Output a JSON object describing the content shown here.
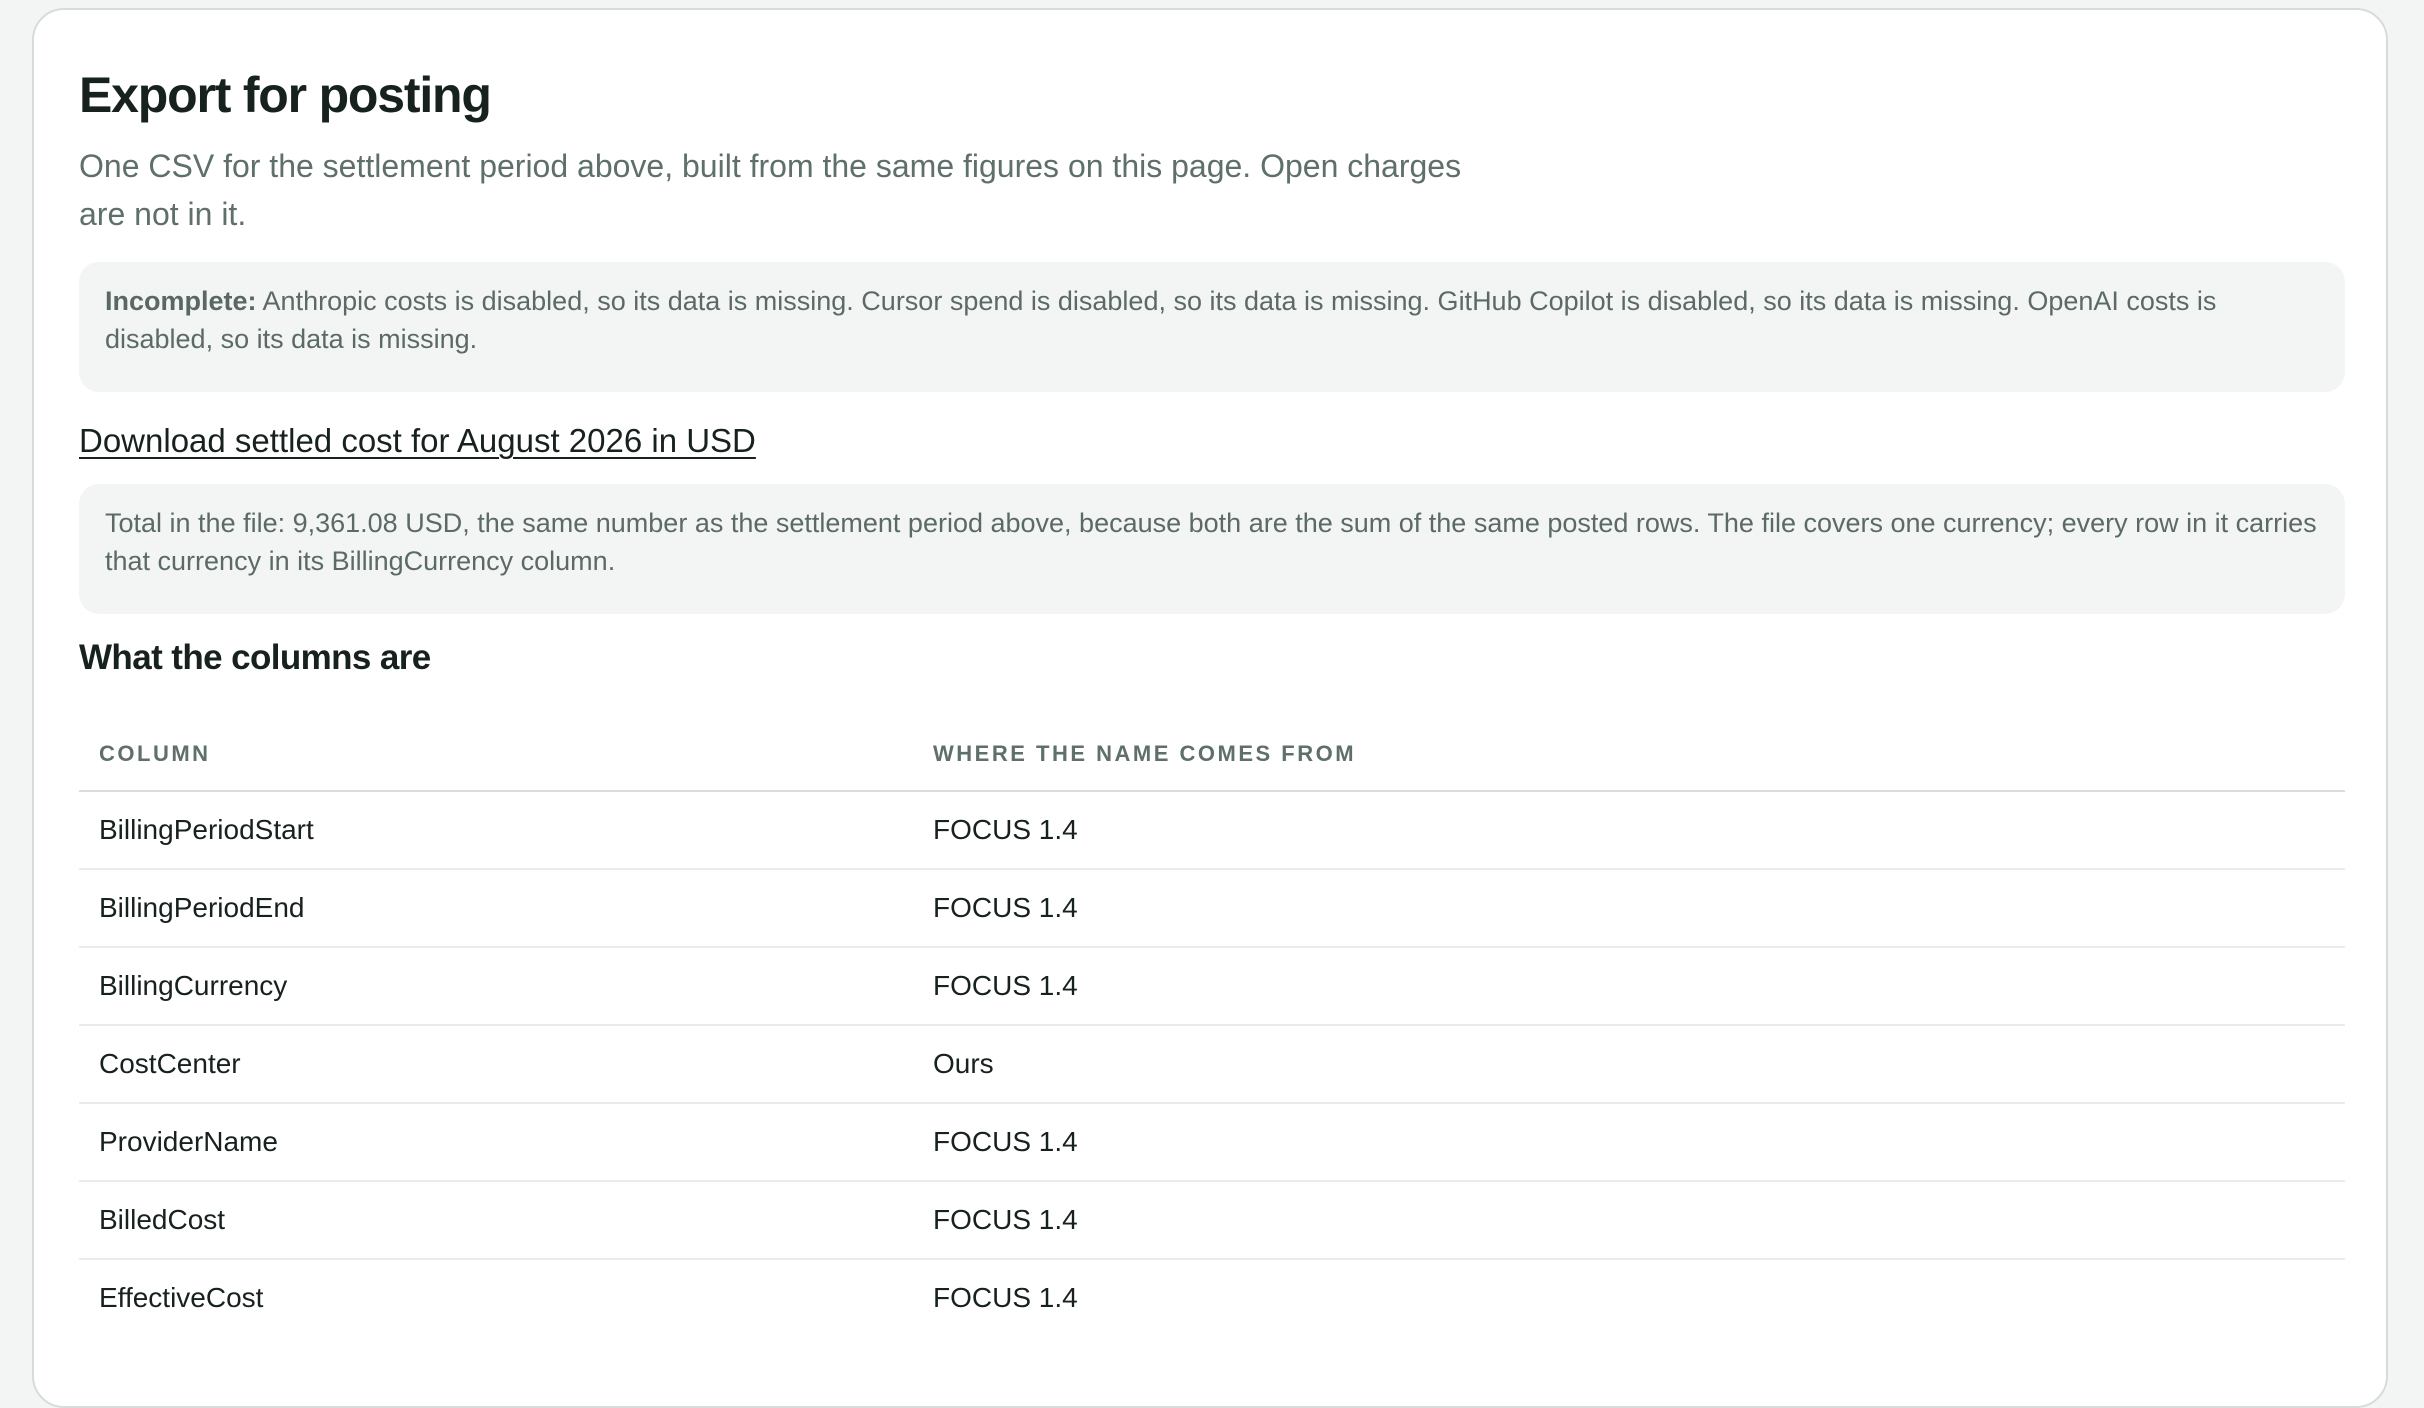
{
  "section": {
    "title": "Export for posting",
    "description": "One CSV for the settlement period above, built from the same figures on this page. Open charges are not in it."
  },
  "warning": {
    "label": "Incomplete:",
    "text": "Anthropic costs is disabled, so its data is missing. Cursor spend is disabled, so its data is missing. GitHub Copilot is disabled, so its data is missing. OpenAI costs is disabled, so its data is missing."
  },
  "download": {
    "label": "Download settled cost for August 2026 in USD"
  },
  "total_note": {
    "text": "Total in the file: 9,361.08 USD, the same number as the settlement period above, because both are the sum of the same posted rows. The file covers one currency; every row in it carries that currency in its BillingCurrency column."
  },
  "columns_section": {
    "title": "What the columns are",
    "headers": [
      "Column",
      "Where the name comes from"
    ],
    "rows": [
      {
        "column": "BillingPeriodStart",
        "source": "FOCUS 1.4"
      },
      {
        "column": "BillingPeriodEnd",
        "source": "FOCUS 1.4"
      },
      {
        "column": "BillingCurrency",
        "source": "FOCUS 1.4"
      },
      {
        "column": "CostCenter",
        "source": "Ours"
      },
      {
        "column": "ProviderName",
        "source": "FOCUS 1.4"
      },
      {
        "column": "BilledCost",
        "source": "FOCUS 1.4"
      },
      {
        "column": "EffectiveCost",
        "source": "FOCUS 1.4"
      }
    ]
  }
}
